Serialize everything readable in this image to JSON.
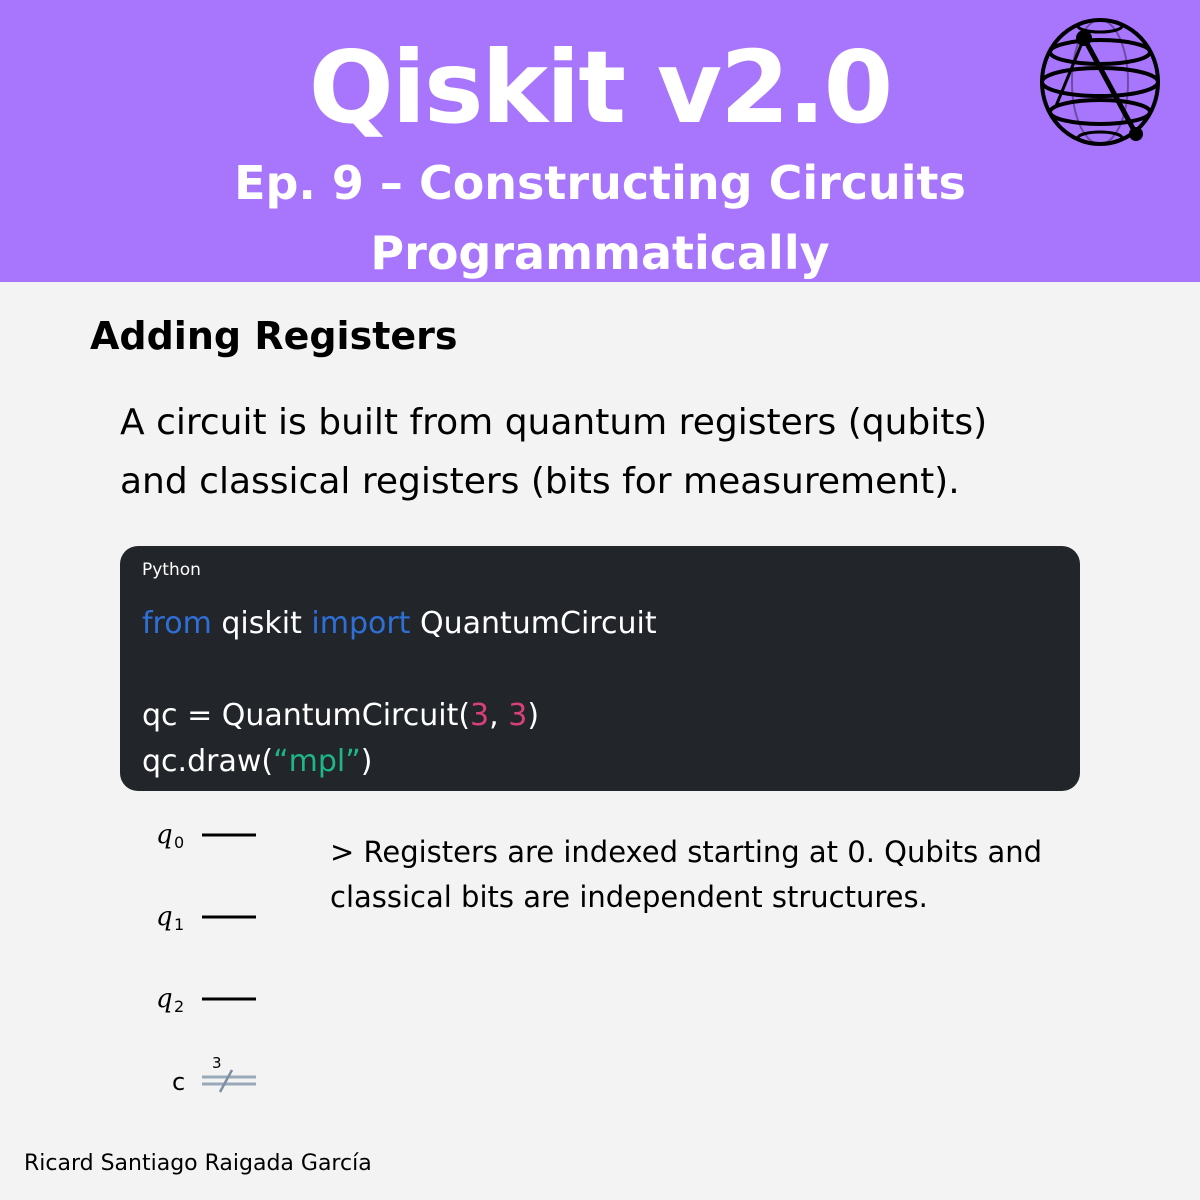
{
  "header": {
    "title": "Qiskit v2.0",
    "subtitle_line1": "Ep. 9 – Constructing Circuits",
    "subtitle_line2": "Programmatically",
    "background_color": "#a876fd",
    "logo_icon": "bloch-sphere-logo-icon"
  },
  "section": {
    "title": "Adding Registers",
    "intro_line1": "A circuit is built from quantum registers (qubits)",
    "intro_line2": "and classical registers (bits for measurement)."
  },
  "code": {
    "language": "Python",
    "line1": {
      "kw1": "from",
      "mod": " qiskit ",
      "kw2": "import",
      "name": " QuantumCircuit"
    },
    "line3": {
      "pre": "qc = QuantumCircuit(",
      "n1": "3",
      "sep": ", ",
      "n2": "3",
      "post": ")"
    },
    "line4": {
      "pre": "qc.draw(",
      "str": "“mpl”",
      "post": ")"
    }
  },
  "circuit": {
    "qubits": [
      "q",
      "q",
      "q"
    ],
    "qubit_indices": [
      "0",
      "1",
      "2"
    ],
    "classical_label": "c",
    "classical_width": "3"
  },
  "note": {
    "line1": "> Registers are indexed starting at 0. Qubits and",
    "line2": "classical bits are independent structures."
  },
  "footer": {
    "author": "Ricard Santiago Raigada García"
  }
}
